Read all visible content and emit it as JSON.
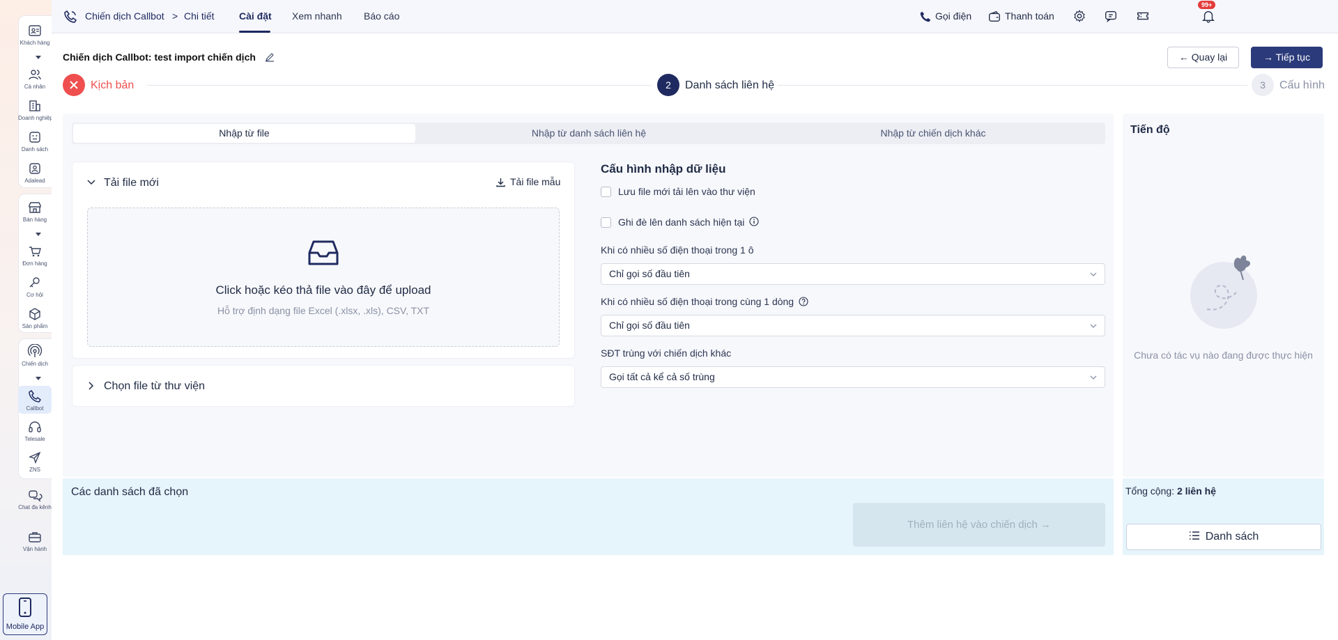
{
  "nav": {
    "crumb_root": "Chiến dịch Callbot",
    "crumb_sep": ">",
    "crumb_current": "Chi tiết",
    "tabs": [
      {
        "label": "Cài đặt",
        "active": true
      },
      {
        "label": "Xem nhanh",
        "active": false
      },
      {
        "label": "Báo cáo",
        "active": false
      }
    ],
    "call_label": "Gọi điện",
    "payment_label": "Thanh toán",
    "notification_badge": "99+"
  },
  "sidebar": {
    "items": [
      {
        "label": "Khách hàng",
        "icon": "contact-card-icon"
      },
      {
        "label": "Cá nhân",
        "icon": "users-icon"
      },
      {
        "label": "Doanh nghiệp",
        "icon": "building-icon"
      },
      {
        "label": "Danh sách",
        "icon": "list-icon"
      },
      {
        "label": "Adalead",
        "icon": "user-badge-icon"
      },
      {
        "label": "Bán hàng",
        "icon": "store-icon"
      },
      {
        "label": "Đơn hàng",
        "icon": "cart-icon"
      },
      {
        "label": "Cơ hội",
        "icon": "key-icon"
      },
      {
        "label": "Sản phẩm",
        "icon": "box-icon"
      },
      {
        "label": "Chiến dịch",
        "icon": "broadcast-icon"
      },
      {
        "label": "Callbot",
        "icon": "phone-icon"
      },
      {
        "label": "Telesale",
        "icon": "headset-icon"
      },
      {
        "label": "ZNS",
        "icon": "send-icon"
      },
      {
        "label": "Chat đa kênh",
        "icon": "chat-icon"
      },
      {
        "label": "Vận hành",
        "icon": "briefcase-icon"
      }
    ],
    "mobile_app": "Mobile App"
  },
  "header": {
    "title": "Chiến dịch Callbot: test import chiến dịch",
    "back_label": "Quay lại",
    "next_label": "Tiếp tục"
  },
  "stepper": {
    "steps": [
      {
        "label": "Kịch bản",
        "state": "error"
      },
      {
        "number": "2",
        "label": "Danh sách liên hệ",
        "state": "active"
      },
      {
        "number": "3",
        "label": "Cấu hình",
        "state": "pending"
      }
    ]
  },
  "import": {
    "tabs": [
      "Nhập từ file",
      "Nhập từ danh sách liên hệ",
      "Nhập từ chiến dịch khác"
    ],
    "upload_title": "Tải file mới",
    "template_label": "Tải file mẫu",
    "drop_main": "Click hoặc kéo thả file vào đây để upload",
    "drop_sub": "Hỗ trợ định dạng file Excel (.xlsx, .xls), CSV, TXT",
    "library_title": "Chọn file từ thư viện"
  },
  "config": {
    "title": "Cấu hình nhập dữ liệu",
    "save_to_library": "Lưu file mới tải lên vào thư viện",
    "overwrite": "Ghi đè lên danh sách hiện tại",
    "multi_in_cell_label": "Khi có nhiều số điện thoại trong 1 ô",
    "multi_in_cell_value": "Chỉ gọi số đầu tiên",
    "multi_in_row_label": "Khi có nhiều số điện thoại trong cùng 1 dòng",
    "multi_in_row_value": "Chỉ gọi số đầu tiên",
    "duplicate_label": "SĐT trùng với chiến dịch khác",
    "duplicate_value": "Gọi tất cả kể cả số trùng"
  },
  "selected": {
    "title": "Các danh sách đã chọn",
    "add_button": "Thêm liên hệ vào chiến dịch"
  },
  "progress": {
    "title": "Tiến độ",
    "empty": "Chưa có tác vụ nào đang được thực hiện",
    "total_label": "Tổng cộng:",
    "total_value": "2 liên hệ",
    "list_button": "Danh sách"
  },
  "colors": {
    "primary": "#2b3a7a",
    "error": "#ef4f4f",
    "strip": "#e6f4fb"
  }
}
